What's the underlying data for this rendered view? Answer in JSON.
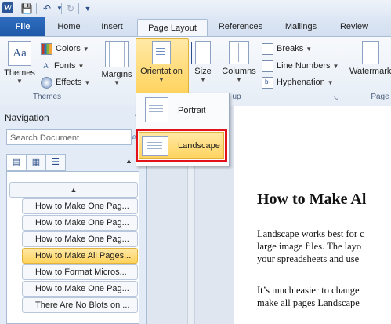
{
  "quick_access": {
    "app_icon": "W",
    "save_icon": "save-icon",
    "undo_icon": "undo-icon",
    "redo_icon": "redo-icon"
  },
  "tabs": {
    "file": "File",
    "home": "Home",
    "insert": "Insert",
    "page_layout": "Page Layout",
    "references": "References",
    "mailings": "Mailings",
    "review": "Review"
  },
  "ribbon": {
    "themes": {
      "label": "Themes",
      "group": "Themes"
    },
    "colors": "Colors",
    "fonts": "Fonts",
    "effects": "Effects",
    "margins": "Margins",
    "orientation": "Orientation",
    "size": "Size",
    "columns": "Columns",
    "breaks": "Breaks",
    "line_numbers": "Line Numbers",
    "hyphenation": "Hyphenation",
    "page_setup_partial": "up",
    "watermark": "Watermark",
    "page_background_partial": "Page"
  },
  "dropdown": {
    "portrait": "Portrait",
    "landscape": "Landscape"
  },
  "navigation": {
    "title": "Navigation",
    "search_placeholder": "Search Document",
    "items": [
      "How to Make One Pag...",
      "How to Make One Pag...",
      "How to Make One Pag...",
      "How to Make All Pages...",
      "How to Format Micros...",
      "How to Make One Pag...",
      "There Are No Blots on ..."
    ]
  },
  "document": {
    "heading": "How to Make Al",
    "p1_l1": "Landscape works best for c",
    "p1_l2": "large image files. The layo",
    "p1_l3": "your spreadsheets and use",
    "p2_l1": "It’s much easier to change",
    "p2_l2": "make all pages Landscape"
  },
  "colors": {
    "accent": "#2b579a",
    "highlight": "#ffd35e",
    "callout": "#e2111a"
  }
}
